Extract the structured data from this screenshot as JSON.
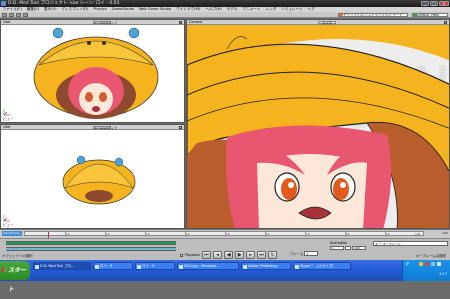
{
  "window": {
    "title": "D.D. Mod Tool プロジェクト: koe  シーン: ロイ - 0.03"
  },
  "menubar": [
    "ファイル(F)",
    "編集(E)",
    "表示(V)",
    "ディスプレイ(D)",
    "Physics",
    "GameStudio",
    "Web Game Studio",
    "ウインドウ(W)",
    "ヘルプ(H)",
    "モデル",
    "アニメート",
    "レンダ",
    "シミュレート",
    "ヘア"
  ],
  "toolbar": {
    "mode": "モデリング/エクストラクション モード",
    "object": "Default_Pass"
  },
  "viewports": {
    "top_left": {
      "label": "User",
      "panel": "パースペクティブ",
      "footer": "ビュー"
    },
    "bottom_left": {
      "label": "User",
      "panel": "パースペクティブ",
      "footer": "ビュー"
    },
    "right": {
      "label": "Camera",
      "panel": "カメラ",
      "watermark": "DEAD OR ALIVE"
    }
  },
  "timeline": {
    "field": "Geo/Frame",
    "start": "1",
    "end": "100",
    "ticks": [
      "10",
      "20",
      "30",
      "40",
      "50",
      "60",
      "70",
      "80",
      "90",
      "100"
    ]
  },
  "status": {
    "object_label": "オブジェクトの選択",
    "playback_label": "Playback",
    "frame_label": "フレーム",
    "frame_value": "1",
    "animation_label": "Animation",
    "key_field": "キー: キーフレーム",
    "hint": "キーフレームの操作"
  },
  "taskbar": {
    "start": "スタート",
    "items": [
      {
        "label": "D.D. Mod Tool プロ..."
      },
      {
        "label": "ロイ - 0"
      },
      {
        "label": "ロイ - 0"
      },
      {
        "label": "DOA.jpg - Windows..."
      },
      {
        "label": "Adobe Photoshop"
      },
      {
        "label": "Skype™ - [スカイプ]"
      }
    ],
    "lang": "JP",
    "clock": "2:17"
  },
  "colors": {
    "hat": "#f5b41d",
    "hair": "#e8566f",
    "timeline_green": "#1f9b59",
    "taskbar": "#245edb"
  }
}
